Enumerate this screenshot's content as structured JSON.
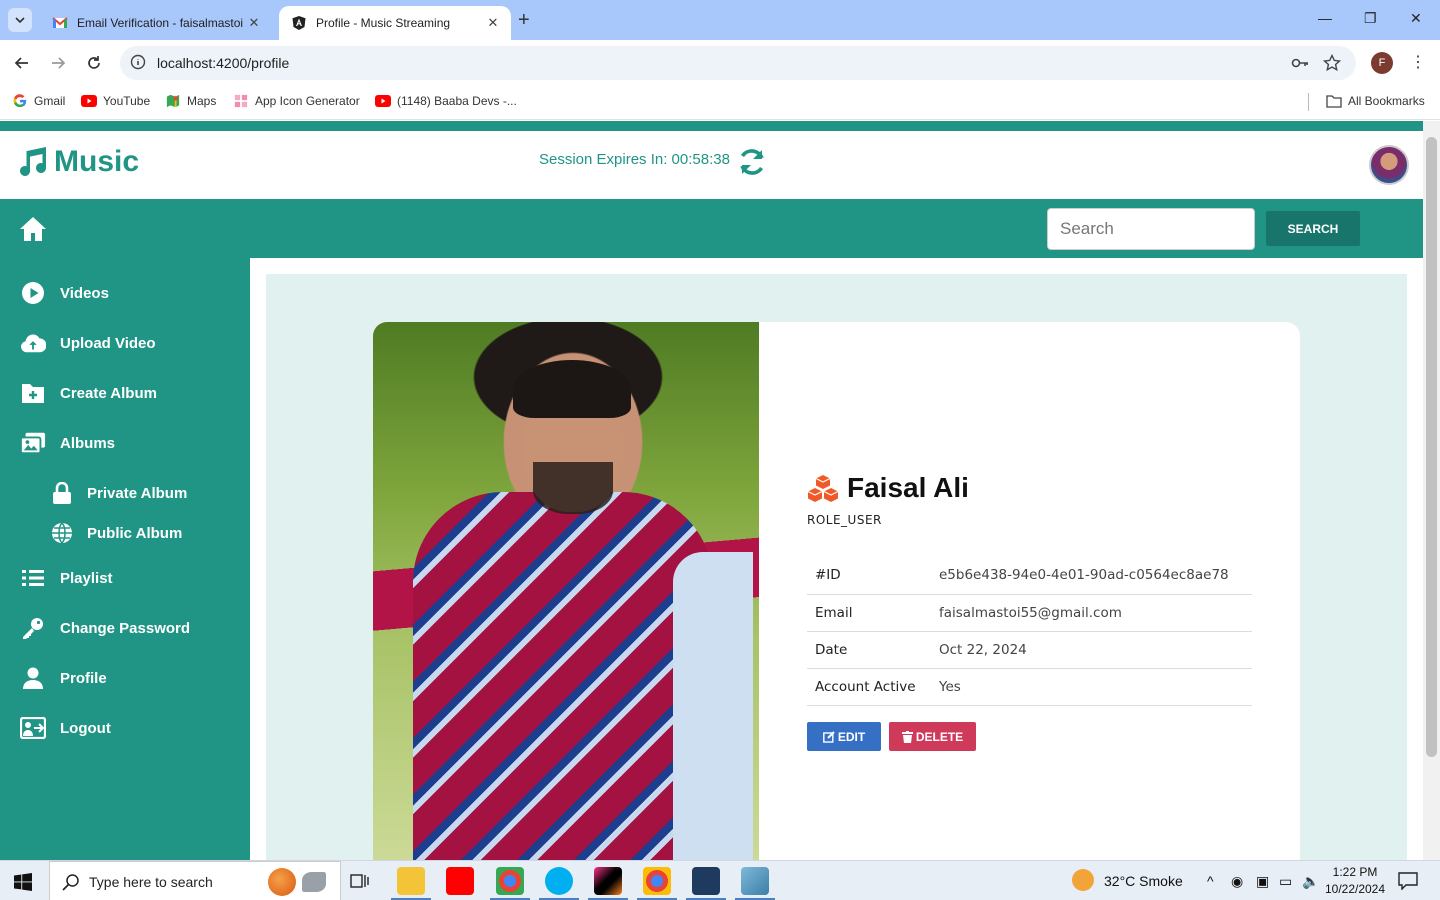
{
  "browser": {
    "tabs": [
      {
        "title": "Email Verification - faisalmastoi",
        "active": false
      },
      {
        "title": "Profile - Music Streaming",
        "active": true
      }
    ],
    "url": "localhost:4200/profile",
    "profile_initial": "F",
    "bookmarks": [
      {
        "label": "Gmail",
        "icon": "google-icon"
      },
      {
        "label": "YouTube",
        "icon": "youtube-icon"
      },
      {
        "label": "Maps",
        "icon": "maps-icon"
      },
      {
        "label": "App Icon Generator",
        "icon": "grid-icon"
      },
      {
        "label": "(1148) Baaba Devs -...",
        "icon": "youtube-icon"
      }
    ],
    "all_bookmarks": "All Bookmarks"
  },
  "header": {
    "brand": "Music",
    "session": "Session Expires In: 00:58:38"
  },
  "navbar": {
    "search_placeholder": "Search",
    "search_button": "SEARCH"
  },
  "sidebar": {
    "items": [
      {
        "label": "Videos",
        "icon": "play-circle-icon"
      },
      {
        "label": "Upload Video",
        "icon": "cloud-upload-icon"
      },
      {
        "label": "Create Album",
        "icon": "folder-plus-icon"
      },
      {
        "label": "Albums",
        "icon": "images-icon"
      },
      {
        "label": "Private Album",
        "icon": "lock-icon"
      },
      {
        "label": "Public Album",
        "icon": "globe-icon"
      },
      {
        "label": "Playlist",
        "icon": "list-icon"
      },
      {
        "label": "Change Password",
        "icon": "key-icon"
      },
      {
        "label": "Profile",
        "icon": "user-icon"
      },
      {
        "label": "Logout",
        "icon": "logout-icon"
      }
    ]
  },
  "profile": {
    "name": "Faisal Ali",
    "role": "ROLE_USER",
    "rows": [
      {
        "key": "#ID",
        "value": "e5b6e438-94e0-4e01-90ad-c0564ec8ae78"
      },
      {
        "key": "Email",
        "value": "faisalmastoi55@gmail.com"
      },
      {
        "key": "Date",
        "value": "Oct 22, 2024"
      },
      {
        "key": "Account Active",
        "value": "Yes"
      }
    ],
    "edit_label": "EDIT",
    "delete_label": "DELETE"
  },
  "taskbar": {
    "search_text": "Type here to search",
    "weather": "32°C  Smoke",
    "time": "1:22 PM",
    "date": "10/22/2024"
  },
  "colors": {
    "primary": "#209585",
    "primary_dark": "#17756b",
    "content_bg": "#e1f1ef",
    "edit": "#3570c4",
    "delete": "#d03a5a"
  }
}
